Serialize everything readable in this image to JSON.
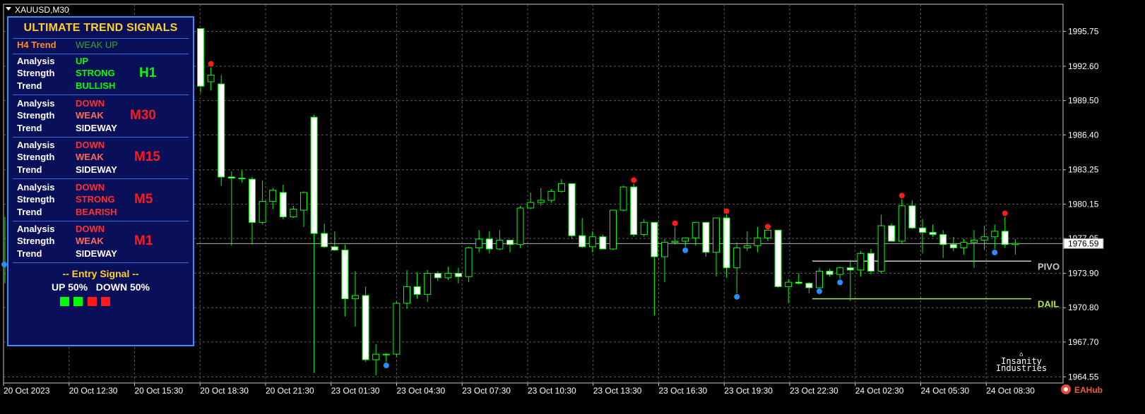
{
  "window": {
    "title": "XAUUSD,M30",
    "watermark": "EAHub"
  },
  "chart_data": {
    "type": "candlestick",
    "symbol": "XAUUSD",
    "timeframe": "M30",
    "ylim": [
      1964.0,
      1998.2
    ],
    "y_ticks": [
      "1995.75",
      "1992.60",
      "1989.50",
      "1986.40",
      "1983.25",
      "1980.15",
      "1977.05",
      "1973.90",
      "1970.80",
      "1967.70",
      "1964.55"
    ],
    "current_price": "1976.59",
    "x_ticks": [
      "20 Oct 2023",
      "20 Oct 12:30",
      "20 Oct 15:30",
      "20 Oct 18:30",
      "20 Oct 21:30",
      "23 Oct 01:30",
      "23 Oct 04:30",
      "23 Oct 07:30",
      "23 Oct 10:30",
      "23 Oct 13:30",
      "23 Oct 16:30",
      "23 Oct 19:30",
      "23 Oct 22:30",
      "24 Oct 02:30",
      "24 Oct 05:30",
      "24 Oct 08:30"
    ],
    "levels": [
      {
        "label": "PIVO",
        "price": 1975.0,
        "color": "#c8c8c8"
      },
      {
        "label": "DAIL",
        "price": 1971.6,
        "color": "#b4e64a"
      }
    ],
    "candles": [
      [
        1996.0,
        1996.0,
        1990.2,
        1990.8
      ],
      [
        1991.2,
        1992.5,
        1990.4,
        1991.8
      ],
      [
        1991.0,
        1991.8,
        1981.8,
        1982.6
      ],
      [
        1982.6,
        1983.1,
        1976.4,
        1982.5
      ],
      [
        1982.5,
        1983.2,
        1982.1,
        1982.5
      ],
      [
        1982.4,
        1982.6,
        1976.5,
        1978.5
      ],
      [
        1978.5,
        1982.3,
        1978.3,
        1980.4
      ],
      [
        1980.4,
        1981.6,
        1979.7,
        1981.4
      ],
      [
        1981.2,
        1981.9,
        1978.8,
        1979.0
      ],
      [
        1979.0,
        1980.0,
        1978.9,
        1979.7
      ],
      [
        1979.6,
        1981.3,
        1978.1,
        1981.2
      ],
      [
        1988.0,
        1988.2,
        1964.9,
        1977.5
      ],
      [
        1977.5,
        1978.4,
        1976.2,
        1976.3
      ],
      [
        1976.3,
        1977.7,
        1975.9,
        1976.0
      ],
      [
        1976.0,
        1976.5,
        1970.0,
        1971.6
      ],
      [
        1971.6,
        1974.1,
        1969.1,
        1971.9
      ],
      [
        1971.9,
        1972.7,
        1965.9,
        1966.1
      ],
      [
        1966.1,
        1967.5,
        1964.7,
        1966.6
      ],
      [
        1966.6,
        1966.7,
        1965.9,
        1966.6
      ],
      [
        1966.6,
        1971.4,
        1966.3,
        1971.2
      ],
      [
        1971.2,
        1974.2,
        1970.7,
        1972.7
      ],
      [
        1972.7,
        1974.0,
        1971.6,
        1972.0
      ],
      [
        1972.0,
        1974.2,
        1971.3,
        1973.9
      ],
      [
        1973.9,
        1974.1,
        1973.2,
        1973.5
      ],
      [
        1973.5,
        1974.5,
        1973.3,
        1973.9
      ],
      [
        1973.9,
        1974.4,
        1973.0,
        1973.6
      ],
      [
        1973.6,
        1976.3,
        1973.1,
        1976.2
      ],
      [
        1976.2,
        1977.8,
        1975.8,
        1977.0
      ],
      [
        1977.0,
        1977.7,
        1975.7,
        1976.1
      ],
      [
        1976.1,
        1977.8,
        1976.0,
        1976.9
      ],
      [
        1976.9,
        1976.9,
        1975.8,
        1976.5
      ],
      [
        1976.5,
        1980.0,
        1976.2,
        1979.8
      ],
      [
        1979.8,
        1981.2,
        1979.7,
        1980.3
      ],
      [
        1980.3,
        1981.6,
        1980.0,
        1980.5
      ],
      [
        1980.5,
        1981.5,
        1980.3,
        1981.3
      ],
      [
        1981.3,
        1982.4,
        1981.2,
        1982.0
      ],
      [
        1982.0,
        1982.0,
        1977.0,
        1977.3
      ],
      [
        1977.3,
        1978.9,
        1976.2,
        1976.3
      ],
      [
        1976.3,
        1977.7,
        1975.8,
        1977.2
      ],
      [
        1977.2,
        1977.4,
        1976.7,
        1976.1
      ],
      [
        1976.1,
        1979.6,
        1976.0,
        1979.6
      ],
      [
        1979.6,
        1981.8,
        1979.5,
        1981.7
      ],
      [
        1981.7,
        1982.0,
        1977.2,
        1977.4
      ],
      [
        1977.4,
        1978.8,
        1977.2,
        1978.5
      ],
      [
        1978.5,
        1978.5,
        1970.1,
        1975.4
      ],
      [
        1975.4,
        1977.0,
        1973.1,
        1976.7
      ],
      [
        1976.7,
        1978.1,
        1976.5,
        1976.8
      ],
      [
        1976.8,
        1977.1,
        1976.3,
        1977.1
      ],
      [
        1977.1,
        1978.5,
        1976.4,
        1978.5
      ],
      [
        1978.5,
        1978.5,
        1975.4,
        1975.8
      ],
      [
        1975.8,
        1978.9,
        1973.6,
        1978.9
      ],
      [
        1978.9,
        1979.2,
        1973.5,
        1974.4
      ],
      [
        1974.4,
        1976.7,
        1972.1,
        1976.2
      ],
      [
        1976.2,
        1977.7,
        1975.9,
        1976.4
      ],
      [
        1976.4,
        1978.1,
        1975.8,
        1977.1
      ],
      [
        1977.1,
        1977.8,
        1976.8,
        1977.8
      ],
      [
        1977.8,
        1977.8,
        1972.6,
        1972.7
      ],
      [
        1972.7,
        1973.4,
        1971.2,
        1973.1
      ],
      [
        1973.1,
        1973.9,
        1972.9,
        1973.0
      ],
      [
        1973.0,
        1973.1,
        1972.1,
        1972.6
      ],
      [
        1972.6,
        1974.4,
        1972.6,
        1974.1
      ],
      [
        1974.1,
        1974.3,
        1973.6,
        1973.8
      ],
      [
        1973.8,
        1974.5,
        1973.4,
        1974.4
      ],
      [
        1974.4,
        1975.1,
        1971.4,
        1974.2
      ],
      [
        1974.2,
        1975.9,
        1973.6,
        1975.7
      ],
      [
        1975.7,
        1976.1,
        1973.8,
        1974.1
      ],
      [
        1974.1,
        1979.2,
        1973.9,
        1978.2
      ],
      [
        1978.2,
        1978.4,
        1976.9,
        1976.8
      ],
      [
        1976.8,
        1980.6,
        1976.6,
        1980.0
      ],
      [
        1980.0,
        1980.5,
        1977.9,
        1978.0
      ],
      [
        1978.0,
        1978.8,
        1975.7,
        1977.6
      ],
      [
        1977.6,
        1978.3,
        1977.2,
        1977.4
      ],
      [
        1977.4,
        1977.8,
        1975.3,
        1976.5
      ],
      [
        1976.5,
        1977.2,
        1975.9,
        1976.2
      ],
      [
        1976.2,
        1977.0,
        1975.6,
        1976.7
      ],
      [
        1976.7,
        1977.8,
        1974.4,
        1976.9
      ],
      [
        1976.9,
        1978.2,
        1976.0,
        1977.2
      ],
      [
        1977.2,
        1978.3,
        1976.1,
        1977.7
      ],
      [
        1977.7,
        1979.0,
        1976.2,
        1976.5
      ],
      [
        1976.5,
        1977.0,
        1975.6,
        1976.6
      ]
    ],
    "red_dots": [
      1,
      42,
      46,
      51,
      55,
      68,
      78
    ],
    "blue_dots": [
      18,
      47,
      52,
      60,
      62,
      77,
      0
    ]
  },
  "panel": {
    "title": "ULTIMATE TREND SIGNALS",
    "h4_label": "H4 Trend",
    "h4_value": "WEAK UP",
    "rows": [
      {
        "tf": "H1",
        "analysis": "UP",
        "strength": "STRONG",
        "trend": "BULLISH"
      },
      {
        "tf": "M30",
        "analysis": "DOWN",
        "strength": "WEAK",
        "trend": "SIDEWAY"
      },
      {
        "tf": "M15",
        "analysis": "DOWN",
        "strength": "WEAK",
        "trend": "SIDEWAY"
      },
      {
        "tf": "M5",
        "analysis": "DOWN",
        "strength": "STRONG",
        "trend": "BEARISH"
      },
      {
        "tf": "M1",
        "analysis": "DOWN",
        "strength": "WEAK",
        "trend": "SIDEWAY"
      }
    ],
    "analysis_label": "Analysis",
    "strength_label": "Strength",
    "trend_label": "Trend",
    "entry_signal": "-- Entry Signal --",
    "up_pct": "UP 50%",
    "down_pct": "DOWN 50%"
  },
  "colors": {
    "bull": "#00ff00",
    "bear": "#ff3030",
    "gold": "#ffd21f",
    "orange": "#ff8c1a",
    "neutral": "#ffffff",
    "weak_up": "#2fa52f"
  },
  "branding": {
    "line1": "Insanity",
    "line2": "Industries"
  }
}
